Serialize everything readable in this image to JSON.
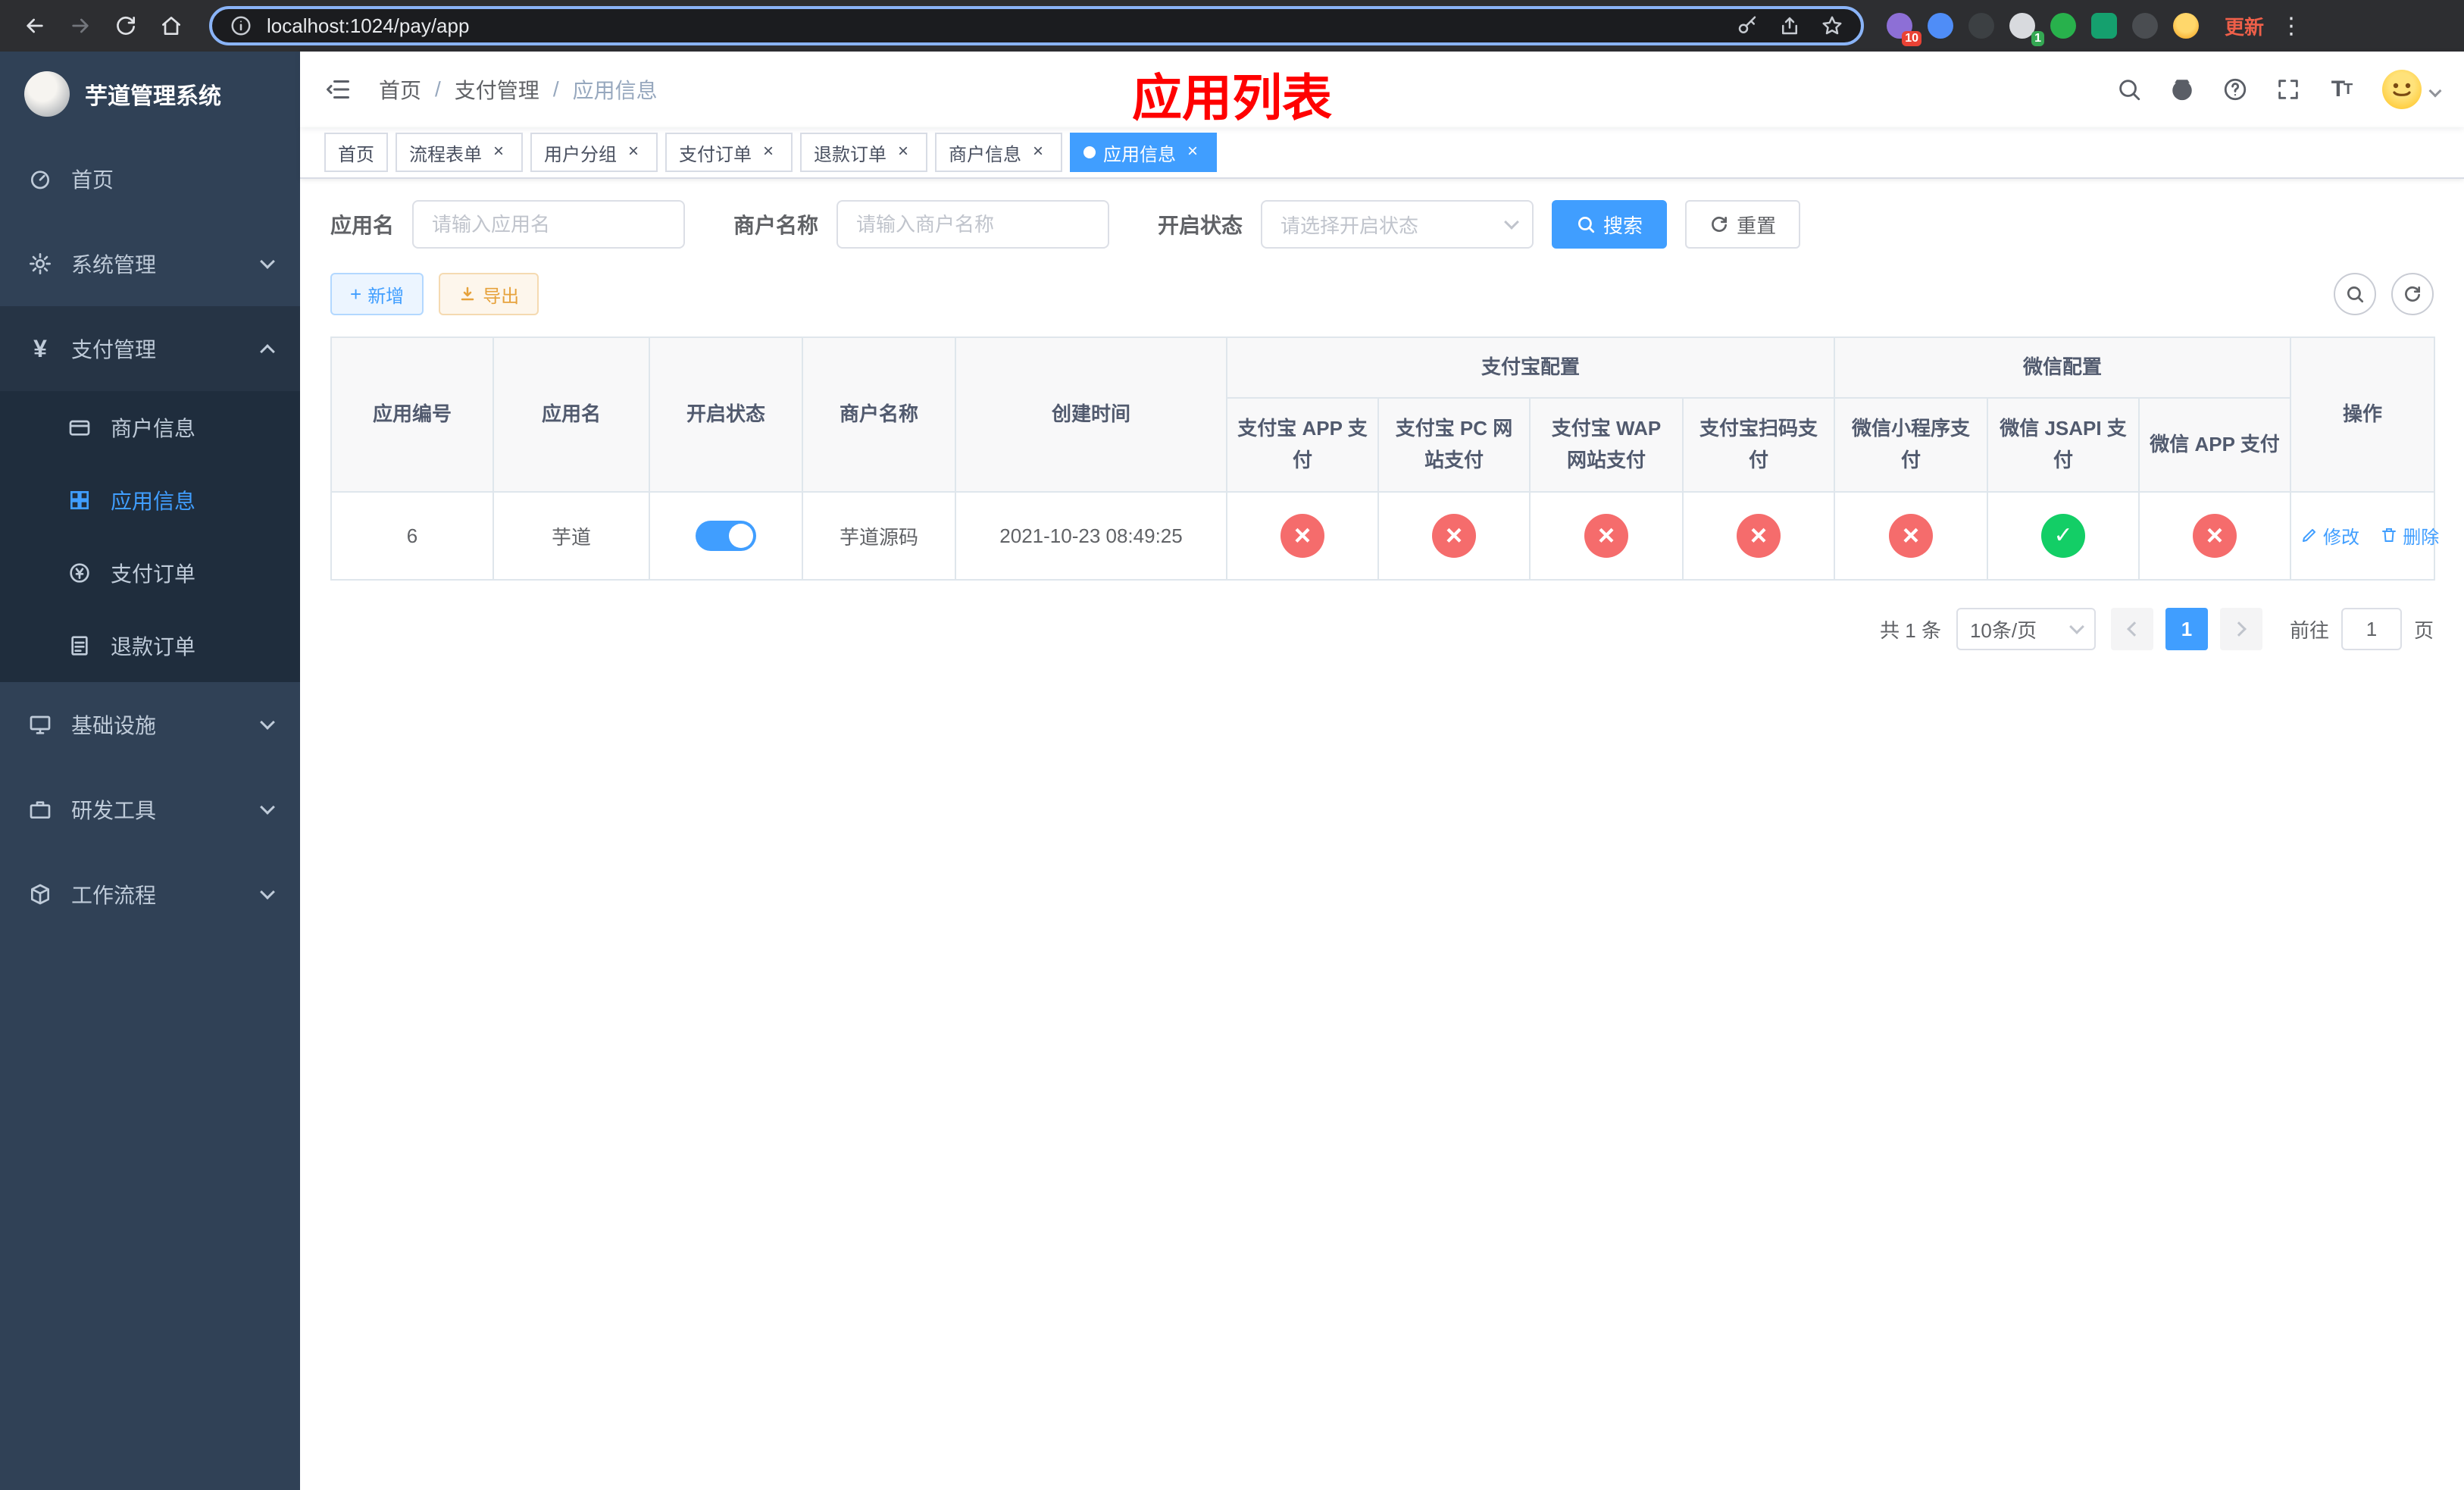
{
  "colors": {
    "accent": "#409eff",
    "danger": "#f56c6c",
    "success": "#13ce66",
    "warning": "#e6a23c",
    "annotation_red": "#ff0000",
    "sidebar_bg": "#304156"
  },
  "browser": {
    "url": "localhost:1024/pay/app",
    "update_label": "更新",
    "ext_badge_red": "10",
    "ext_badge_green": "1"
  },
  "sidebar": {
    "title": "芋道管理系统",
    "menu": [
      {
        "label": "首页"
      },
      {
        "label": "系统管理"
      },
      {
        "label": "支付管理"
      },
      {
        "label": "商户信息"
      },
      {
        "label": "应用信息"
      },
      {
        "label": "支付订单"
      },
      {
        "label": "退款订单"
      },
      {
        "label": "基础设施"
      },
      {
        "label": "研发工具"
      },
      {
        "label": "工作流程"
      }
    ]
  },
  "header": {
    "breadcrumb": [
      "首页",
      "支付管理",
      "应用信息"
    ],
    "annotation": "应用列表"
  },
  "tabs": [
    {
      "label": "首页"
    },
    {
      "label": "流程表单"
    },
    {
      "label": "用户分组"
    },
    {
      "label": "支付订单"
    },
    {
      "label": "退款订单"
    },
    {
      "label": "商户信息"
    },
    {
      "label": "应用信息"
    }
  ],
  "filters": {
    "app_name": {
      "label": "应用名",
      "placeholder": "请输入应用名"
    },
    "merchant": {
      "label": "商户名称",
      "placeholder": "请输入商户名称"
    },
    "status": {
      "label": "开启状态",
      "placeholder": "请选择开启状态"
    },
    "search": "搜索",
    "reset": "重置"
  },
  "toolbar": {
    "add": "新增",
    "export": "导出"
  },
  "table": {
    "columns": {
      "app_id": "应用编号",
      "app_name": "应用名",
      "status": "开启状态",
      "merchant": "商户名称",
      "created": "创建时间",
      "alipay_group": "支付宝配置",
      "wechat_group": "微信配置",
      "alipay_app": "支付宝 APP 支付",
      "alipay_pc": "支付宝 PC 网站支付",
      "alipay_wap": "支付宝 WAP 网站支付",
      "alipay_qr": "支付宝扫码支付",
      "wechat_lite": "微信小程序支付",
      "wechat_jsapi": "微信 JSAPI 支付",
      "wechat_app": "微信 APP 支付",
      "op": "操作"
    },
    "rows": [
      {
        "app_id": "6",
        "app_name": "芋道",
        "status_on": true,
        "merchant": "芋道源码",
        "created": "2021-10-23 08:49:25",
        "alipay_app": false,
        "alipay_pc": false,
        "alipay_wap": false,
        "alipay_qr": false,
        "wechat_lite": false,
        "wechat_jsapi": true,
        "wechat_app": false,
        "edit": "修改",
        "delete": "删除"
      }
    ]
  },
  "pagination": {
    "total": "共 1 条",
    "page_size": "10条/页",
    "page": "1",
    "goto": "前往",
    "goto_value": "1",
    "unit": "页"
  }
}
